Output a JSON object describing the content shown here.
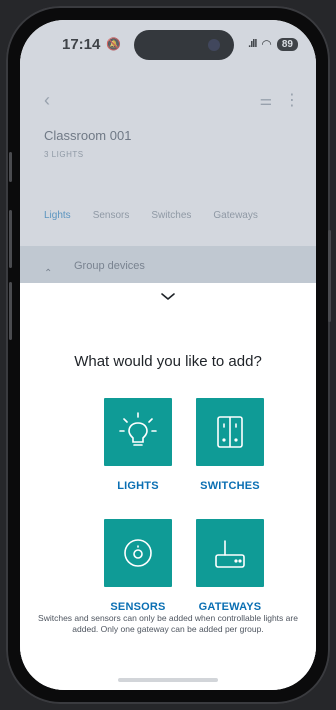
{
  "status_bar": {
    "time": "17:14",
    "battery": "89"
  },
  "background_screen": {
    "room_title": "Classroom 001",
    "room_subtitle": "3 LIGHTS",
    "tabs": [
      "Lights",
      "Sensors",
      "Switches",
      "Gateways"
    ],
    "active_tab": "Lights",
    "group_row_label": "Group devices"
  },
  "sheet": {
    "title": "What would you like to add?",
    "options": [
      {
        "label": "LIGHTS",
        "icon": "lightbulb-icon"
      },
      {
        "label": "SWITCHES",
        "icon": "switch-icon"
      },
      {
        "label": "SENSORS",
        "icon": "sensor-icon"
      },
      {
        "label": "GATEWAYS",
        "icon": "gateway-icon"
      }
    ],
    "footnote": "Switches and sensors can only be added when controllable lights are added. Only one gateway can be added per group."
  },
  "colors": {
    "tile": "#0f9b96",
    "label": "#0a6fb3",
    "active_tab": "#3c8ec9"
  }
}
